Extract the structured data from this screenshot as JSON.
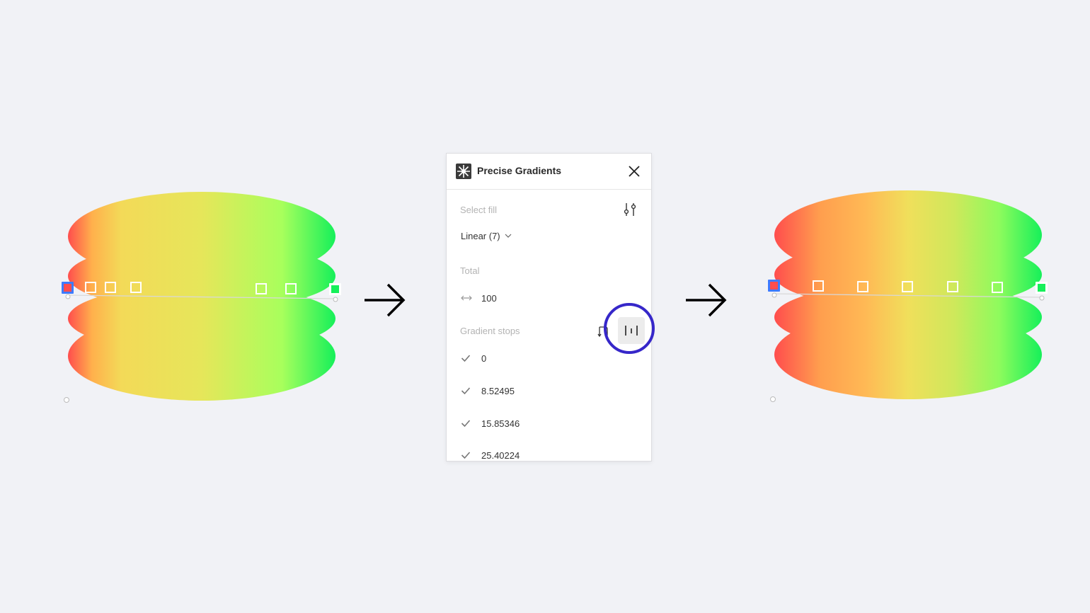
{
  "panel": {
    "title": "Precise Gradients",
    "select_fill_label": "Select fill",
    "fill_value": "Linear (7)",
    "total_label": "Total",
    "total_value": "100",
    "gradient_stops_label": "Gradient stops",
    "stops": [
      "0",
      "8.52495",
      "15.85346",
      "25.40224"
    ]
  },
  "icons": {
    "logo": "plugin-logo-icon",
    "close": "close-icon",
    "settings": "sliders-icon",
    "dropdown": "chevron-down-icon",
    "total": "double-arrow-icon",
    "reverse": "reverse-icon",
    "distribute": "distribute-evenly-icon",
    "check": "check-icon",
    "arrow": "arrow-right-icon"
  },
  "colors": {
    "gradient_start": "#ff4d4d",
    "gradient_mid_orange": "#ffb04c",
    "gradient_mid_yellow": "#f0df5b",
    "gradient_light_green": "#a8ff5c",
    "gradient_end": "#16f05a",
    "highlight": "#3627c9",
    "selection": "#3d7bff"
  }
}
